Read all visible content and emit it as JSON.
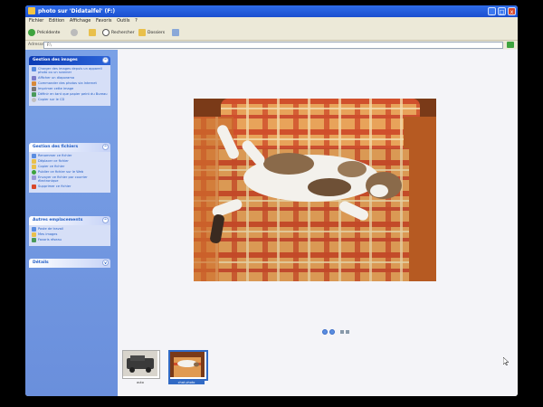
{
  "window": {
    "title": "photo sur 'Didatalfel' (F:)",
    "min_label": "_",
    "max_label": "□",
    "close_label": "x"
  },
  "menu": [
    "Fichier",
    "Edition",
    "Affichage",
    "Favoris",
    "Outils",
    "?"
  ],
  "toolbar": {
    "back_label": "Précédente",
    "search_label": "Rechercher",
    "folders_label": "Dossiers"
  },
  "address": {
    "label": "Adresse",
    "value": "F:\\"
  },
  "panels": {
    "image_tasks": {
      "title": "Gestion des images",
      "items": [
        "Charger des images depuis un appareil photo ou un scanner",
        "Afficher un diaporama",
        "Commander des photos via Internet",
        "Imprimer cette image",
        "Définir en tant que papier peint du Bureau",
        "Copier sur le CD"
      ]
    },
    "file_tasks": {
      "title": "Gestion des fichiers",
      "items": [
        "Renommer ce fichier",
        "Déplacer ce fichier",
        "Copier ce fichier",
        "Publier ce fichier sur le Web",
        "Envoyer ce fichier par courrier électronique",
        "Supprimer ce fichier"
      ]
    },
    "other_places": {
      "title": "Autres emplacements",
      "items": [
        "Poste de travail",
        "Mes images",
        "Favoris réseau"
      ]
    },
    "details": {
      "title": "Détails"
    }
  },
  "filmstrip": {
    "thumbs": [
      {
        "label": "auto",
        "selected": false
      },
      {
        "label": "chat photo",
        "selected": true
      }
    ]
  },
  "colors": {
    "titlebar": "#1a4fcf",
    "taskpane": "#6a8fdc",
    "link": "#215dc6",
    "selection": "#316ac5"
  }
}
